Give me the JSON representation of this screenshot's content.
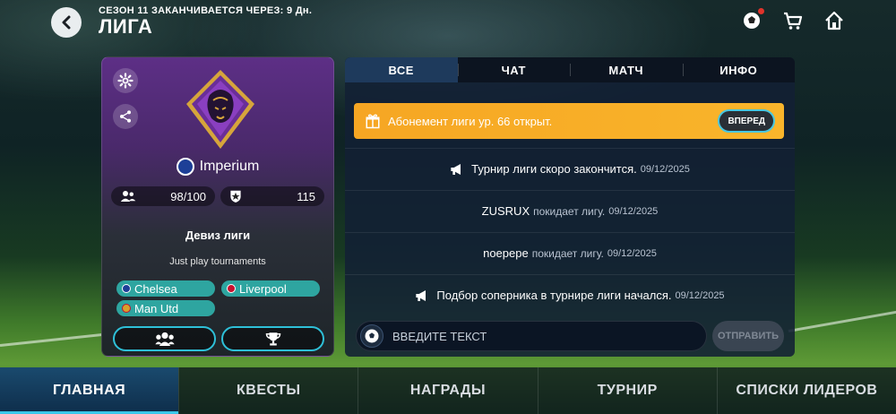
{
  "header": {
    "season_text": "СЕЗОН 11 ЗАКАНЧИВАЕТСЯ ЧЕРЕЗ: 9 Дн.",
    "title": "ЛИГА",
    "icons": [
      "back-icon",
      "football-notification-icon",
      "cart-icon",
      "home-icon"
    ]
  },
  "league_card": {
    "club_name": "Imperium",
    "members": "98/100",
    "rating": "115",
    "motto_label": "Девиз лиги",
    "motto": "Just play tournaments",
    "teams": [
      "Chelsea",
      "Liverpool",
      "Man Utd"
    ],
    "icons": [
      "gear-icon",
      "share-icon",
      "members-icon",
      "star-shield-icon",
      "lion-crest-icon",
      "trophy-icon"
    ]
  },
  "tabs": [
    "ВСЕ",
    "ЧАТ",
    "МАТЧ",
    "ИНФО"
  ],
  "banner": {
    "message": "Абонемент лиги ур. 66 открыт.",
    "button_label": "ВПЕРЕД"
  },
  "messages": [
    {
      "type": "announcement",
      "text": "Турнир лиги скоро закончится.",
      "date": "09/12/2025"
    },
    {
      "type": "user",
      "user": "ZUSRUX",
      "text": "покидает лигу.",
      "date": "09/12/2025"
    },
    {
      "type": "user",
      "user": "noерере",
      "text": "покидает лигу.",
      "date": "09/12/2025"
    },
    {
      "type": "announcement",
      "text": "Подбор соперника в турнире лиги начался.",
      "date": "09/12/2025"
    }
  ],
  "chat_input": {
    "placeholder": "ВВЕДИТЕ ТЕКСТ",
    "send_label": "ОТПРАВИТЬ"
  },
  "bottom_nav": [
    "ГЛАВНАЯ",
    "КВЕСТЫ",
    "НАГРАДЫ",
    "ТУРНИР",
    "СПИСКИ ЛИДЕРОВ"
  ],
  "colors": {
    "accent": "#2ec0d8",
    "banner": "#f6a623",
    "team_chip": "#2ea5a0",
    "card_top": "#5d2f86"
  }
}
